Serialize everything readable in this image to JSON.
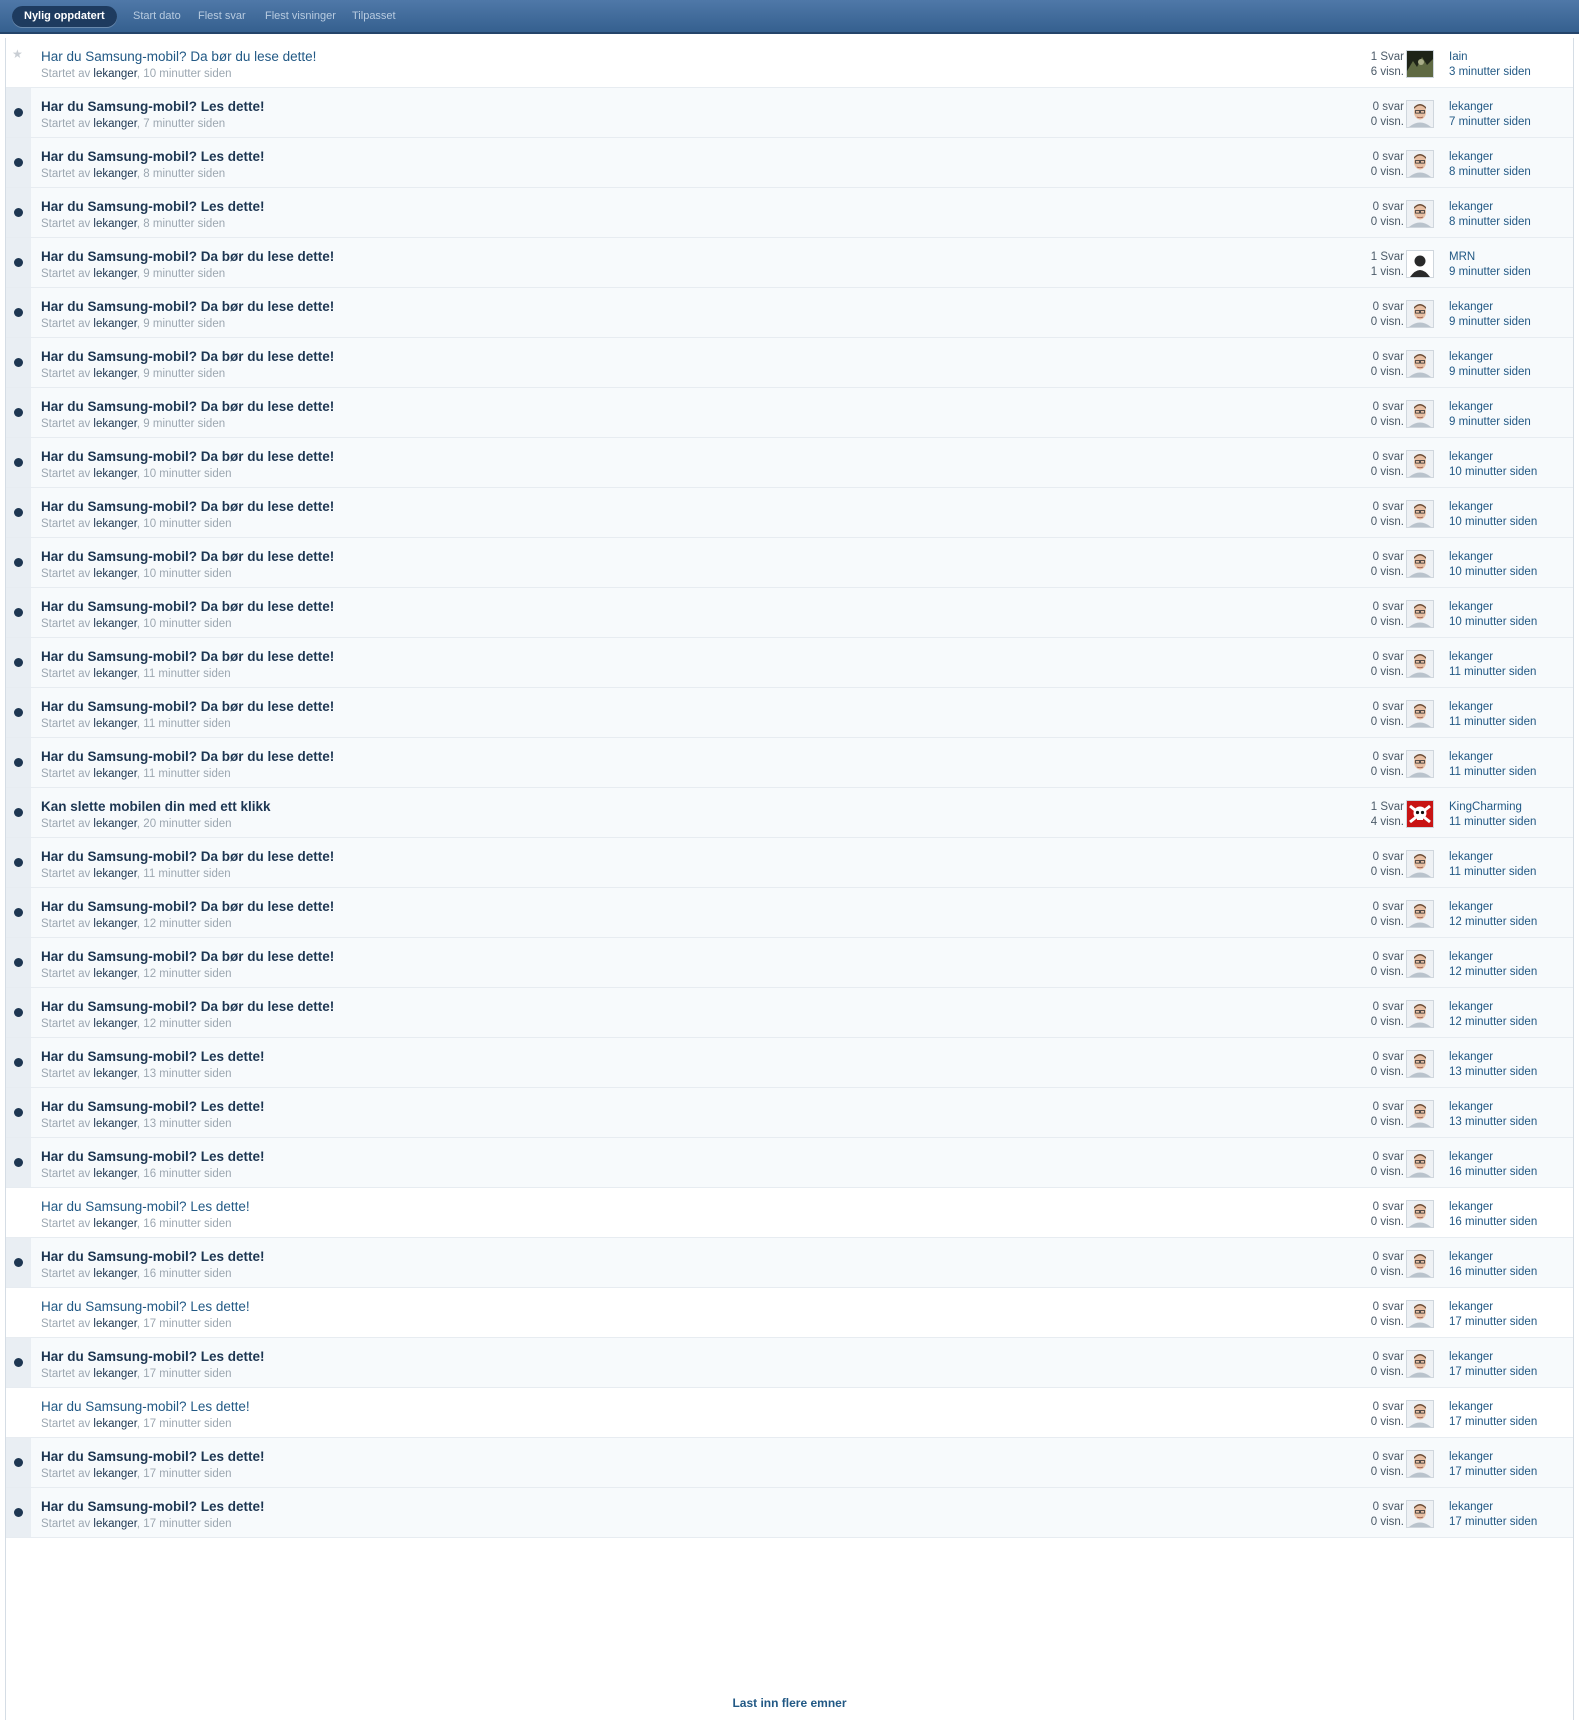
{
  "tabs": [
    {
      "label": "Nylig oppdatert",
      "active": true
    },
    {
      "label": "Start dato",
      "active": false
    },
    {
      "label": "Flest svar",
      "active": false
    },
    {
      "label": "Flest visninger",
      "active": false
    },
    {
      "label": "Tilpasset",
      "active": false
    }
  ],
  "started_by_label": "Startet av",
  "load_more_label": "Last inn flere emner",
  "topics": [
    {
      "title": "Har du Samsung-mobil? Da bør du lese dette!",
      "author": "lekanger",
      "started": "10 minutter siden",
      "replies": "1 Svar",
      "views": "6 visn.",
      "last_user": "Iain",
      "last_time": "3 minutter siden",
      "status": "star",
      "avatar": "dark"
    },
    {
      "title": "Har du Samsung-mobil? Les dette!",
      "author": "lekanger",
      "started": "7 minutter siden",
      "replies": "0 svar",
      "views": "0 visn.",
      "last_user": "lekanger",
      "last_time": "7 minutter siden",
      "status": "unread",
      "avatar": "face"
    },
    {
      "title": "Har du Samsung-mobil? Les dette!",
      "author": "lekanger",
      "started": "8 minutter siden",
      "replies": "0 svar",
      "views": "0 visn.",
      "last_user": "lekanger",
      "last_time": "8 minutter siden",
      "status": "unread",
      "avatar": "face"
    },
    {
      "title": "Har du Samsung-mobil? Les dette!",
      "author": "lekanger",
      "started": "8 minutter siden",
      "replies": "0 svar",
      "views": "0 visn.",
      "last_user": "lekanger",
      "last_time": "8 minutter siden",
      "status": "unread",
      "avatar": "face"
    },
    {
      "title": "Har du Samsung-mobil? Da bør du lese dette!",
      "author": "lekanger",
      "started": "9 minutter siden",
      "replies": "1 Svar",
      "views": "1 visn.",
      "last_user": "MRN",
      "last_time": "9 minutter siden",
      "status": "unread",
      "avatar": "silhouette"
    },
    {
      "title": "Har du Samsung-mobil? Da bør du lese dette!",
      "author": "lekanger",
      "started": "9 minutter siden",
      "replies": "0 svar",
      "views": "0 visn.",
      "last_user": "lekanger",
      "last_time": "9 minutter siden",
      "status": "unread",
      "avatar": "face"
    },
    {
      "title": "Har du Samsung-mobil? Da bør du lese dette!",
      "author": "lekanger",
      "started": "9 minutter siden",
      "replies": "0 svar",
      "views": "0 visn.",
      "last_user": "lekanger",
      "last_time": "9 minutter siden",
      "status": "unread",
      "avatar": "face"
    },
    {
      "title": "Har du Samsung-mobil? Da bør du lese dette!",
      "author": "lekanger",
      "started": "9 minutter siden",
      "replies": "0 svar",
      "views": "0 visn.",
      "last_user": "lekanger",
      "last_time": "9 minutter siden",
      "status": "unread",
      "avatar": "face"
    },
    {
      "title": "Har du Samsung-mobil? Da bør du lese dette!",
      "author": "lekanger",
      "started": "10 minutter siden",
      "replies": "0 svar",
      "views": "0 visn.",
      "last_user": "lekanger",
      "last_time": "10 minutter siden",
      "status": "unread",
      "avatar": "face"
    },
    {
      "title": "Har du Samsung-mobil? Da bør du lese dette!",
      "author": "lekanger",
      "started": "10 minutter siden",
      "replies": "0 svar",
      "views": "0 visn.",
      "last_user": "lekanger",
      "last_time": "10 minutter siden",
      "status": "unread",
      "avatar": "face"
    },
    {
      "title": "Har du Samsung-mobil? Da bør du lese dette!",
      "author": "lekanger",
      "started": "10 minutter siden",
      "replies": "0 svar",
      "views": "0 visn.",
      "last_user": "lekanger",
      "last_time": "10 minutter siden",
      "status": "unread",
      "avatar": "face"
    },
    {
      "title": "Har du Samsung-mobil? Da bør du lese dette!",
      "author": "lekanger",
      "started": "10 minutter siden",
      "replies": "0 svar",
      "views": "0 visn.",
      "last_user": "lekanger",
      "last_time": "10 minutter siden",
      "status": "unread",
      "avatar": "face"
    },
    {
      "title": "Har du Samsung-mobil? Da bør du lese dette!",
      "author": "lekanger",
      "started": "11 minutter siden",
      "replies": "0 svar",
      "views": "0 visn.",
      "last_user": "lekanger",
      "last_time": "11 minutter siden",
      "status": "unread",
      "avatar": "face"
    },
    {
      "title": "Har du Samsung-mobil? Da bør du lese dette!",
      "author": "lekanger",
      "started": "11 minutter siden",
      "replies": "0 svar",
      "views": "0 visn.",
      "last_user": "lekanger",
      "last_time": "11 minutter siden",
      "status": "unread",
      "avatar": "face"
    },
    {
      "title": "Har du Samsung-mobil? Da bør du lese dette!",
      "author": "lekanger",
      "started": "11 minutter siden",
      "replies": "0 svar",
      "views": "0 visn.",
      "last_user": "lekanger",
      "last_time": "11 minutter siden",
      "status": "unread",
      "avatar": "face"
    },
    {
      "title": "Kan slette mobilen din med ett klikk",
      "author": "lekanger",
      "started": "20 minutter siden",
      "replies": "1 Svar",
      "views": "4 visn.",
      "last_user": "KingCharming",
      "last_time": "11 minutter siden",
      "status": "unread",
      "avatar": "skull"
    },
    {
      "title": "Har du Samsung-mobil? Da bør du lese dette!",
      "author": "lekanger",
      "started": "11 minutter siden",
      "replies": "0 svar",
      "views": "0 visn.",
      "last_user": "lekanger",
      "last_time": "11 minutter siden",
      "status": "unread",
      "avatar": "face"
    },
    {
      "title": "Har du Samsung-mobil? Da bør du lese dette!",
      "author": "lekanger",
      "started": "12 minutter siden",
      "replies": "0 svar",
      "views": "0 visn.",
      "last_user": "lekanger",
      "last_time": "12 minutter siden",
      "status": "unread",
      "avatar": "face"
    },
    {
      "title": "Har du Samsung-mobil? Da bør du lese dette!",
      "author": "lekanger",
      "started": "12 minutter siden",
      "replies": "0 svar",
      "views": "0 visn.",
      "last_user": "lekanger",
      "last_time": "12 minutter siden",
      "status": "unread",
      "avatar": "face"
    },
    {
      "title": "Har du Samsung-mobil? Da bør du lese dette!",
      "author": "lekanger",
      "started": "12 minutter siden",
      "replies": "0 svar",
      "views": "0 visn.",
      "last_user": "lekanger",
      "last_time": "12 minutter siden",
      "status": "unread",
      "avatar": "face"
    },
    {
      "title": "Har du Samsung-mobil? Les dette!",
      "author": "lekanger",
      "started": "13 minutter siden",
      "replies": "0 svar",
      "views": "0 visn.",
      "last_user": "lekanger",
      "last_time": "13 minutter siden",
      "status": "unread",
      "avatar": "face"
    },
    {
      "title": "Har du Samsung-mobil? Les dette!",
      "author": "lekanger",
      "started": "13 minutter siden",
      "replies": "0 svar",
      "views": "0 visn.",
      "last_user": "lekanger",
      "last_time": "13 minutter siden",
      "status": "unread",
      "avatar": "face"
    },
    {
      "title": "Har du Samsung-mobil? Les dette!",
      "author": "lekanger",
      "started": "16 minutter siden",
      "replies": "0 svar",
      "views": "0 visn.",
      "last_user": "lekanger",
      "last_time": "16 minutter siden",
      "status": "unread",
      "avatar": "face"
    },
    {
      "title": "Har du Samsung-mobil? Les dette!",
      "author": "lekanger",
      "started": "16 minutter siden",
      "replies": "0 svar",
      "views": "0 visn.",
      "last_user": "lekanger",
      "last_time": "16 minutter siden",
      "status": "read",
      "avatar": "face"
    },
    {
      "title": "Har du Samsung-mobil? Les dette!",
      "author": "lekanger",
      "started": "16 minutter siden",
      "replies": "0 svar",
      "views": "0 visn.",
      "last_user": "lekanger",
      "last_time": "16 minutter siden",
      "status": "unread",
      "avatar": "face"
    },
    {
      "title": "Har du Samsung-mobil? Les dette!",
      "author": "lekanger",
      "started": "17 minutter siden",
      "replies": "0 svar",
      "views": "0 visn.",
      "last_user": "lekanger",
      "last_time": "17 minutter siden",
      "status": "read",
      "avatar": "face"
    },
    {
      "title": "Har du Samsung-mobil? Les dette!",
      "author": "lekanger",
      "started": "17 minutter siden",
      "replies": "0 svar",
      "views": "0 visn.",
      "last_user": "lekanger",
      "last_time": "17 minutter siden",
      "status": "unread",
      "avatar": "face"
    },
    {
      "title": "Har du Samsung-mobil? Les dette!",
      "author": "lekanger",
      "started": "17 minutter siden",
      "replies": "0 svar",
      "views": "0 visn.",
      "last_user": "lekanger",
      "last_time": "17 minutter siden",
      "status": "read",
      "avatar": "face"
    },
    {
      "title": "Har du Samsung-mobil? Les dette!",
      "author": "lekanger",
      "started": "17 minutter siden",
      "replies": "0 svar",
      "views": "0 visn.",
      "last_user": "lekanger",
      "last_time": "17 minutter siden",
      "status": "unread",
      "avatar": "face"
    },
    {
      "title": "Har du Samsung-mobil? Les dette!",
      "author": "lekanger",
      "started": "17 minutter siden",
      "replies": "0 svar",
      "views": "0 visn.",
      "last_user": "lekanger",
      "last_time": "17 minutter siden",
      "status": "unread",
      "avatar": "face"
    }
  ]
}
